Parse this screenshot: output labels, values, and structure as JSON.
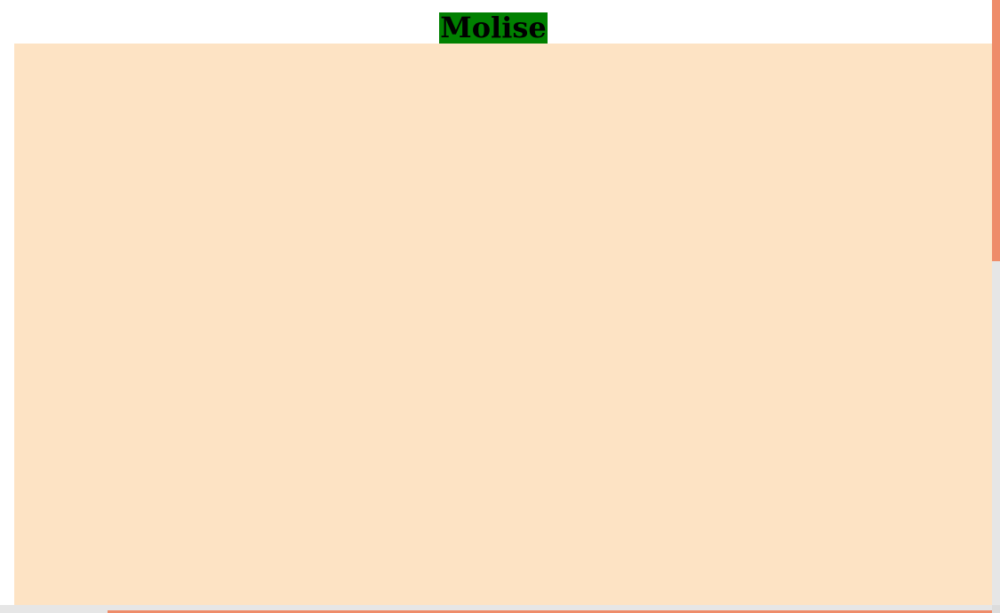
{
  "page": {
    "title": "Molise"
  },
  "colors": {
    "title_background": "#008000",
    "content_background": "#fde3c4",
    "scrollbar_track": "#e6e6e6",
    "scrollbar_thumb": "#ee8c6a"
  },
  "scroll": {
    "vertical_position": 0.0,
    "horizontal_position": 0.11
  }
}
